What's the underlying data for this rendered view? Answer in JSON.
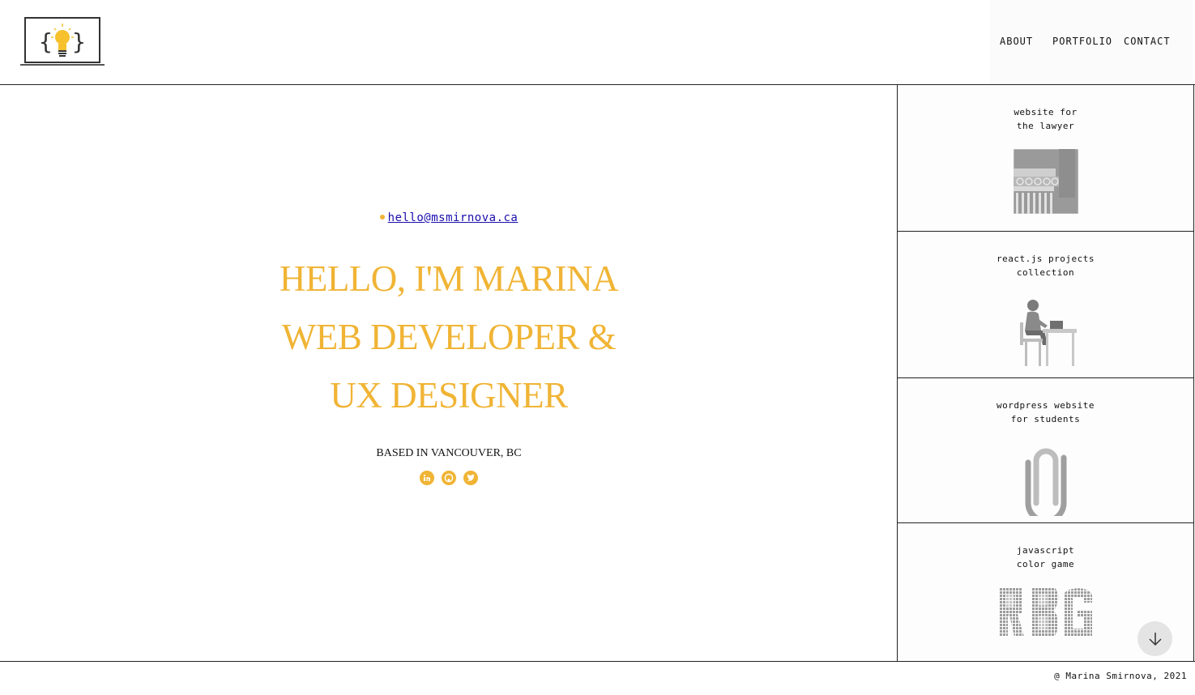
{
  "header": {
    "logo_icon": "lightbulb-code-logo",
    "nav": [
      {
        "label": "ABOUT"
      },
      {
        "label": "PORTFOLIO"
      },
      {
        "label": "CONTACT"
      }
    ]
  },
  "hero": {
    "email": "hello@msmirnova.ca",
    "headline_lines": [
      "HELLO, I'M MARINA",
      "WEB DEVELOPER &",
      "UX DESIGNER"
    ],
    "location": "BASED IN VANCOUVER, BC",
    "socials": [
      {
        "icon": "linkedin-icon"
      },
      {
        "icon": "github-icon"
      },
      {
        "icon": "twitter-icon"
      }
    ],
    "accent_color": "#f0b435"
  },
  "portfolio": [
    {
      "title": "website for\nthe lawyer",
      "icon": "column-capital-icon"
    },
    {
      "title": "react.js projects\ncollection",
      "icon": "woman-at-laptop-icon"
    },
    {
      "title": "wordpress website\nfor students",
      "icon": "paperclip-icon"
    },
    {
      "title": "javascript\ncolor game",
      "icon": "rgb-mosaic-icon"
    }
  ],
  "scroll_button": {
    "icon": "arrow-down-icon"
  },
  "footer": {
    "copyright": "@ Marina Smirnova, 2021"
  }
}
